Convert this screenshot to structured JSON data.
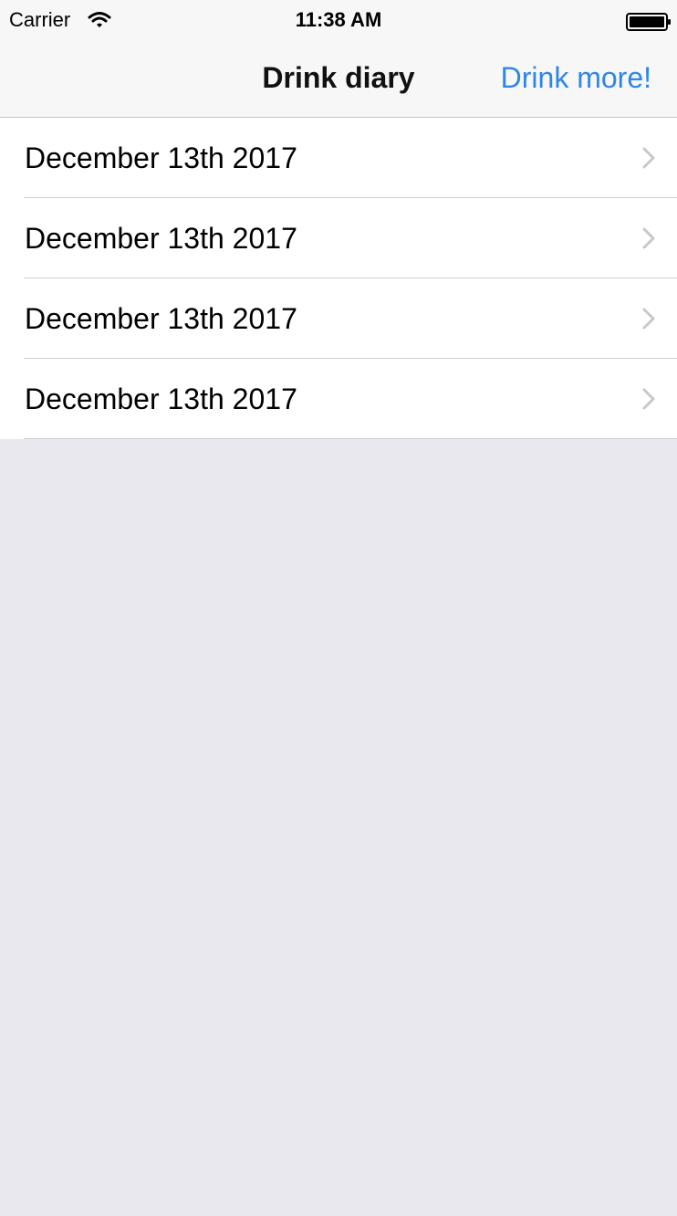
{
  "status_bar": {
    "carrier": "Carrier",
    "wifi_icon": "wifi-icon",
    "time": "11:38 AM",
    "battery_icon": "battery-icon"
  },
  "nav": {
    "title": "Drink diary",
    "action_label": "Drink more!"
  },
  "list": {
    "items": [
      {
        "label": "December 13th 2017",
        "icon": "chevron-right-icon"
      },
      {
        "label": "December 13th 2017",
        "icon": "chevron-right-icon"
      },
      {
        "label": "December 13th 2017",
        "icon": "chevron-right-icon"
      },
      {
        "label": "December 13th 2017",
        "icon": "chevron-right-icon"
      }
    ]
  },
  "colors": {
    "accent": "#2f86ea",
    "background": "#e9e8ef",
    "nav_background": "#f7f7f7",
    "separator": "#cfcfd4",
    "chevron": "#c7c7cc"
  }
}
